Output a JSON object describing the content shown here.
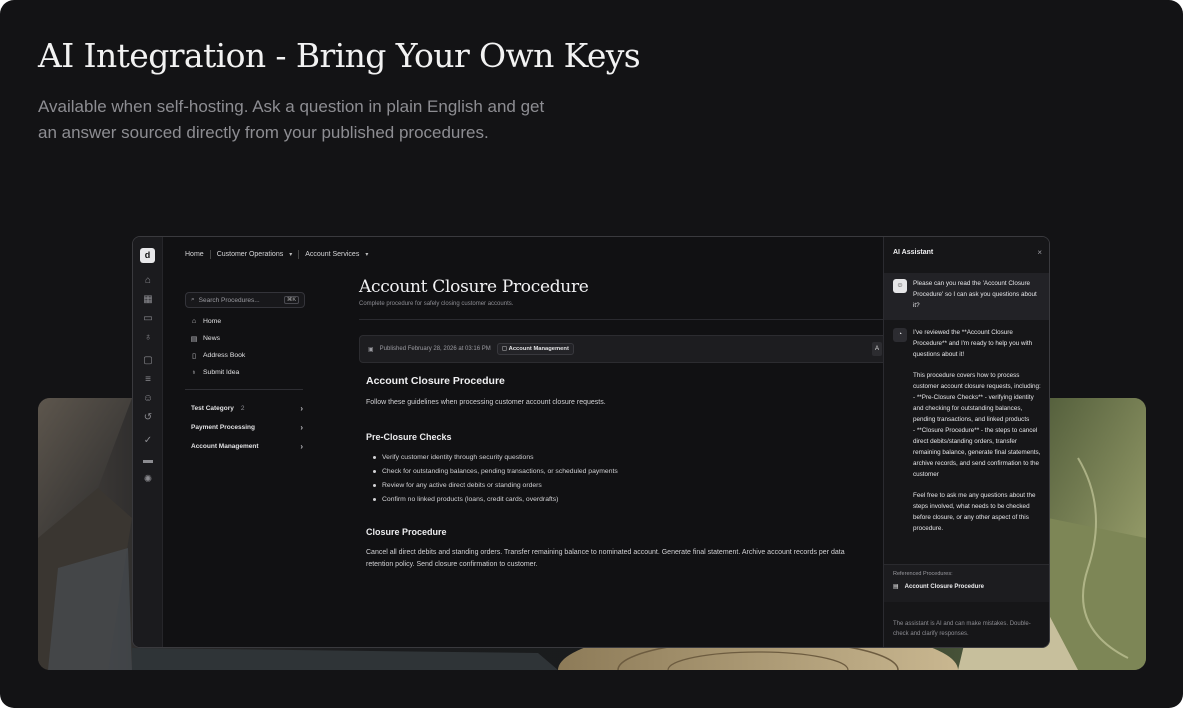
{
  "hero": {
    "title": "AI Integration - Bring Your Own Keys",
    "subtitle_line1": "Available when self-hosting. Ask a question in plain English and get",
    "subtitle_line2": "an answer sourced directly from your published procedures."
  },
  "rail": {
    "icons": [
      "home-icon",
      "dashboard-icon",
      "inbox-icon",
      "lightbulb-icon",
      "folder-icon",
      "database-icon",
      "users-icon",
      "history-icon",
      "user-check-icon",
      "card-icon",
      "settings-icon"
    ]
  },
  "breadcrumb": {
    "items": [
      "Home",
      "Customer Operations",
      "Account Services"
    ]
  },
  "sidebar": {
    "search_placeholder": "Search Procedures...",
    "search_shortcut": "⌘K",
    "nav": [
      {
        "label": "Home",
        "icon": "home-icon"
      },
      {
        "label": "News",
        "icon": "news-icon"
      },
      {
        "label": "Address Book",
        "icon": "book-icon"
      },
      {
        "label": "Submit Idea",
        "icon": "lightbulb-icon"
      }
    ],
    "categories": [
      {
        "label": "Test Category",
        "count": "2"
      },
      {
        "label": "Payment Processing",
        "count": ""
      },
      {
        "label": "Account Management",
        "count": ""
      }
    ]
  },
  "document": {
    "title": "Account Closure Procedure",
    "subtitle": "Complete procedure for safely closing customer accounts.",
    "published": "Published February 28, 2026 at 03:16 PM",
    "category_chip": "Account Management",
    "action_label": "A",
    "heading": "Account Closure Procedure",
    "intro": "Follow these guidelines when processing customer account closure requests.",
    "section1_heading": "Pre-Closure Checks",
    "checks": [
      "Verify customer identity through security questions",
      "Check for outstanding balances, pending transactions, or scheduled payments",
      "Review for any active direct debits or standing orders",
      "Confirm no linked products (loans, credit cards, overdrafts)"
    ],
    "section2_heading": "Closure Procedure",
    "closure_line1": "Cancel all direct debits and standing orders. Transfer remaining balance to nominated account. Generate final statement. Archive account records per data",
    "closure_line2": "retention policy. Send closure confirmation to customer."
  },
  "assistant": {
    "title": "AI Assistant",
    "close": "×",
    "user_message": "Please can you read the 'Account Closure Procedure' so I can ask you questions about it?",
    "bot_message": "I've reviewed the **Account Closure Procedure** and I'm ready to help you with questions about it!\n\nThis procedure covers how to process customer account closure requests, including:\n- **Pre-Closure Checks** - verifying identity and checking for outstanding balances, pending transactions, and linked products\n- **Closure Procedure** - the steps to cancel direct debits/standing orders, transfer remaining balance, generate final statements, archive records, and send confirmation to the customer\n\nFeel free to ask me any questions about the steps involved, what needs to be checked before closure, or any other aspect of this procedure.",
    "referenced_label": "Referenced Procedures:",
    "referenced_item": "Account Closure Procedure",
    "disclaimer": "The assistant is AI and can make mistakes. Double-check and clarify responses."
  }
}
